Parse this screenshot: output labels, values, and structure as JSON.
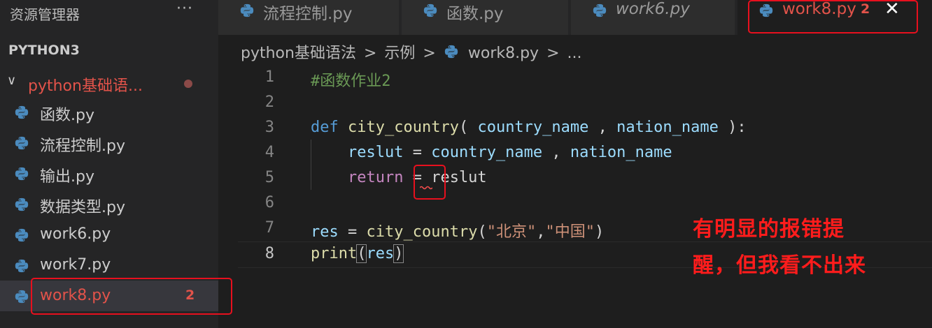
{
  "explorer": {
    "title": "资源管理器",
    "more": "···",
    "section": "PYTHON3",
    "folder": {
      "chevron": "∨",
      "name": "python基础语..."
    },
    "files": [
      {
        "name": "函数.py",
        "badge": ""
      },
      {
        "name": "流程控制.py",
        "badge": ""
      },
      {
        "name": "输出.py",
        "badge": ""
      },
      {
        "name": "数据类型.py",
        "badge": ""
      },
      {
        "name": "work6.py",
        "badge": ""
      },
      {
        "name": "work7.py",
        "badge": ""
      },
      {
        "name": "work8.py",
        "badge": "2"
      }
    ]
  },
  "tabs": [
    {
      "label": "流程控制.py"
    },
    {
      "label": "函数.py"
    },
    {
      "label": "work6.py"
    },
    {
      "label": "work8.py",
      "badge": "2",
      "close": "✕"
    }
  ],
  "breadcrumb": {
    "folder": "python基础语法",
    "sep": ">",
    "sub": "示例",
    "file": "work8.py",
    "more": "..."
  },
  "editor": {
    "line_numbers": [
      "1",
      "2",
      "3",
      "4",
      "5",
      "6",
      "7",
      "8"
    ],
    "lines": {
      "l1_comment": "#函数作业2",
      "l3_def": "def",
      "l3_fn": "city_country",
      "l3_open": "( ",
      "l3_p1": "country_name",
      "l3_comma": " , ",
      "l3_p2": "nation_name",
      "l3_close": " ):",
      "l4_indent": "    ",
      "l4_var": "reslut",
      "l4_eq": " = ",
      "l4_p1": "country_name",
      "l4_comma": " , ",
      "l4_p2": "nation_name",
      "l5_indent": "    ",
      "l5_kw": "return",
      "l5_rest": " = reslut",
      "l7_var": "res",
      "l7_eq": " = ",
      "l7_fn": "city_country",
      "l7_open": "(",
      "l7_s1": "\"北京\"",
      "l7_comma": ",",
      "l7_s2": "\"中国\"",
      "l7_close": ")",
      "l8_fn": "print",
      "l8_open": "(",
      "l8_var": "res",
      "l8_close": ")"
    }
  },
  "annotation": {
    "line1": "有明显的报错提",
    "line2": "醒，但我看不出来"
  },
  "colors": {
    "error_red": "#e8101e",
    "annotation_red": "#ff1c1c",
    "modified_red": "#e2534a",
    "python_blue": "#4b8bbe"
  }
}
